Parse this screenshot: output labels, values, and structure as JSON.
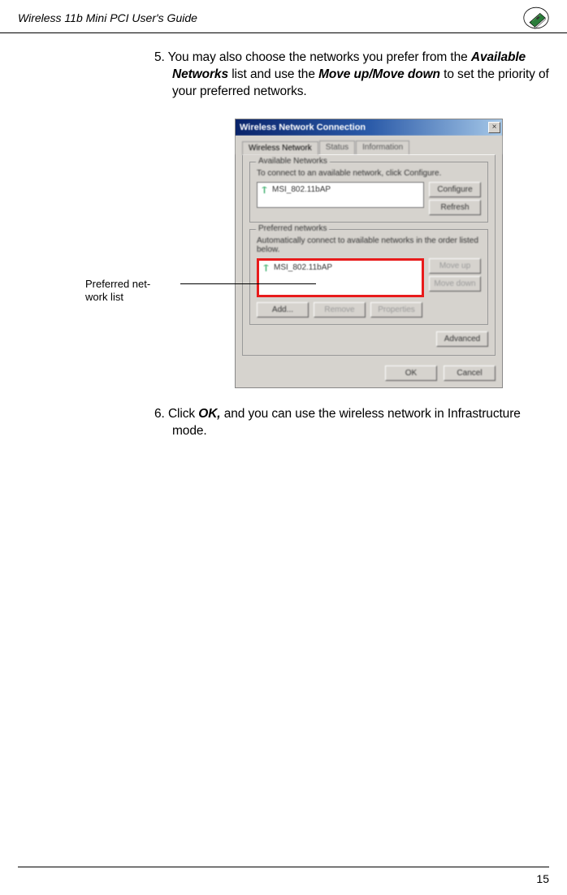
{
  "header_title": "Wireless 11b Mini PCI  User's Guide",
  "step5": {
    "number": "5.",
    "p1a": "You may also choose the networks you prefer from the ",
    "b1": "Available Networks",
    "p1b": " list and use the ",
    "b2": "Move up/Move down",
    "p1c": " to set the priority of your preferred networks."
  },
  "callout_label_l1": "Preferred net-",
  "callout_label_l2": "work list",
  "dialog": {
    "title": "Wireless Network Connection",
    "tabs": {
      "t1": "Wireless Network",
      "t2": "Status",
      "t3": "Information"
    },
    "available": {
      "legend": "Available Networks",
      "desc": "To connect to an available network, click Configure.",
      "item": "MSI_802.11bAP",
      "configure": "Configure",
      "refresh": "Refresh"
    },
    "preferred": {
      "legend": "Preferred networks",
      "desc": "Automatically connect to available networks in the order listed below.",
      "item": "MSI_802.11bAP",
      "moveup": "Move up",
      "movedown": "Move down",
      "add": "Add...",
      "remove": "Remove",
      "properties": "Properties"
    },
    "advanced": "Advanced",
    "ok": "OK",
    "cancel": "Cancel"
  },
  "step6": {
    "number": "6.",
    "p1a": "Click ",
    "b1": "OK,",
    "p1b": " and you can use the wireless network in Infrastructure mode."
  },
  "page_number": "15"
}
